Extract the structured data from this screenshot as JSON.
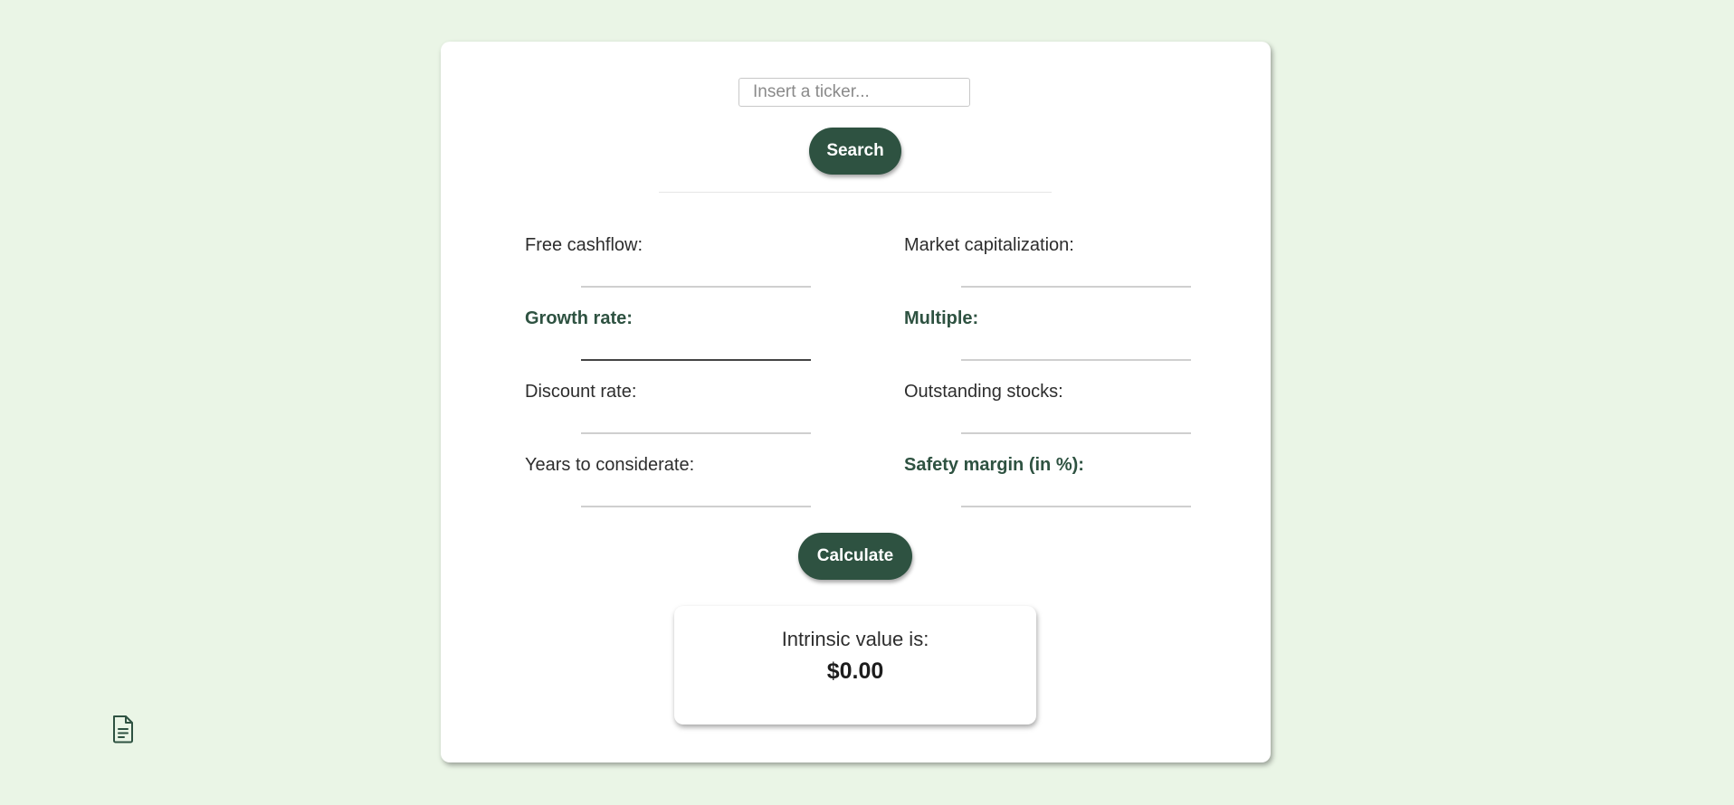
{
  "search": {
    "placeholder": "Insert a ticker...",
    "value": "",
    "button_label": "Search"
  },
  "fields": {
    "free_cashflow": {
      "label": "Free cashflow:",
      "value": ""
    },
    "market_cap": {
      "label": "Market capitalization:",
      "value": ""
    },
    "growth_rate": {
      "label": "Growth rate:",
      "value": ""
    },
    "multiple": {
      "label": "Multiple:",
      "value": ""
    },
    "discount_rate": {
      "label": "Discount rate:",
      "value": ""
    },
    "outstanding_stocks": {
      "label": "Outstanding stocks:",
      "value": ""
    },
    "years": {
      "label": "Years to considerate:",
      "value": ""
    },
    "safety_margin": {
      "label": "Safety margin (in %):",
      "value": ""
    }
  },
  "calculate": {
    "button_label": "Calculate"
  },
  "result": {
    "label": "Intrinsic value is:",
    "value": "$0.00"
  },
  "icons": {
    "floating_doc": "document-icon"
  },
  "colors": {
    "background": "#eaf5e6",
    "accent": "#2e5241",
    "card": "#ffffff"
  }
}
